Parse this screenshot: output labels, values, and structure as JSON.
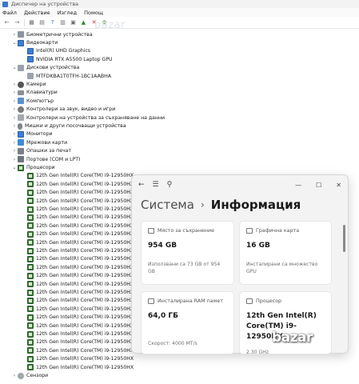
{
  "window_title": "Диспечер на устройства",
  "menu": [
    "Файл",
    "Действие",
    "Изглед",
    "Помощ"
  ],
  "watermark": "bazar",
  "tree": [
    {
      "level": 0,
      "expanded": false,
      "icon": "gray",
      "label": "Биометрични устройства"
    },
    {
      "level": 0,
      "expanded": true,
      "icon": "mon",
      "label": "Видеокарти"
    },
    {
      "level": 1,
      "icon": "mon",
      "label": "Intel(R) UHD Graphics"
    },
    {
      "level": 1,
      "icon": "mon",
      "label": "NVIDIA RTX A5500 Laptop GPU"
    },
    {
      "level": 0,
      "expanded": true,
      "icon": "disk",
      "label": "Дискови устройства"
    },
    {
      "level": 1,
      "icon": "disk",
      "label": "MTFDKBA1T0TFH-1BC1AABHA"
    },
    {
      "level": 0,
      "expanded": false,
      "icon": "cam",
      "label": "Камери"
    },
    {
      "level": 0,
      "expanded": false,
      "icon": "kbd",
      "label": "Клавиатури"
    },
    {
      "level": 0,
      "expanded": false,
      "icon": "pc",
      "label": "Компютър"
    },
    {
      "level": 0,
      "expanded": false,
      "icon": "snd",
      "label": "Контролери за звук, видео и игри"
    },
    {
      "level": 0,
      "expanded": false,
      "icon": "ctrl",
      "label": "Контролери на устройства за съхраняване на данни"
    },
    {
      "level": 0,
      "expanded": false,
      "icon": "mouse",
      "label": "Мишки и други посочващи устройства"
    },
    {
      "level": 0,
      "expanded": false,
      "icon": "mon",
      "label": "Монитори"
    },
    {
      "level": 0,
      "expanded": false,
      "icon": "net",
      "label": "Мрежови карти"
    },
    {
      "level": 0,
      "expanded": false,
      "icon": "prt",
      "label": "Опашки за печат"
    },
    {
      "level": 0,
      "expanded": false,
      "icon": "port",
      "label": "Портове (COM и LPT)"
    },
    {
      "level": 0,
      "expanded": true,
      "icon": "cpu",
      "label": "Процесори"
    },
    {
      "level": 1,
      "icon": "cpu",
      "label": "12th Gen Intel(R) Core(TM) i9-12950HX"
    },
    {
      "level": 1,
      "icon": "cpu",
      "label": "12th Gen Intel(R) Core(TM) i9-12950HX"
    },
    {
      "level": 1,
      "icon": "cpu",
      "label": "12th Gen Intel(R) Core(TM) i9-12950HX"
    },
    {
      "level": 1,
      "icon": "cpu",
      "label": "12th Gen Intel(R) Core(TM) i9-12950HX"
    },
    {
      "level": 1,
      "icon": "cpu",
      "label": "12th Gen Intel(R) Core(TM) i9-12950HX"
    },
    {
      "level": 1,
      "icon": "cpu",
      "label": "12th Gen Intel(R) Core(TM) i9-12950HX"
    },
    {
      "level": 1,
      "icon": "cpu",
      "label": "12th Gen Intel(R) Core(TM) i9-12950HX"
    },
    {
      "level": 1,
      "icon": "cpu",
      "label": "12th Gen Intel(R) Core(TM) i9-12950HX"
    },
    {
      "level": 1,
      "icon": "cpu",
      "label": "12th Gen Intel(R) Core(TM) i9-12950HX"
    },
    {
      "level": 1,
      "icon": "cpu",
      "label": "12th Gen Intel(R) Core(TM) i9-12950HX"
    },
    {
      "level": 1,
      "icon": "cpu",
      "label": "12th Gen Intel(R) Core(TM) i9-12950HX"
    },
    {
      "level": 1,
      "icon": "cpu",
      "label": "12th Gen Intel(R) Core(TM) i9-12950HX"
    },
    {
      "level": 1,
      "icon": "cpu",
      "label": "12th Gen Intel(R) Core(TM) i9-12950HX"
    },
    {
      "level": 1,
      "icon": "cpu",
      "label": "12th Gen Intel(R) Core(TM) i9-12950HX"
    },
    {
      "level": 1,
      "icon": "cpu",
      "label": "12th Gen Intel(R) Core(TM) i9-12950HX"
    },
    {
      "level": 1,
      "icon": "cpu",
      "label": "12th Gen Intel(R) Core(TM) i9-12950HX"
    },
    {
      "level": 1,
      "icon": "cpu",
      "label": "12th Gen Intel(R) Core(TM) i9-12950HX"
    },
    {
      "level": 1,
      "icon": "cpu",
      "label": "12th Gen Intel(R) Core(TM) i9-12950HX"
    },
    {
      "level": 1,
      "icon": "cpu",
      "label": "12th Gen Intel(R) Core(TM) i9-12950HX"
    },
    {
      "level": 1,
      "icon": "cpu",
      "label": "12th Gen Intel(R) Core(TM) i9-12950HX"
    },
    {
      "level": 1,
      "icon": "cpu",
      "label": "12th Gen Intel(R) Core(TM) i9-12950HX"
    },
    {
      "level": 1,
      "icon": "cpu",
      "label": "12th Gen Intel(R) Core(TM) i9-12950HX"
    },
    {
      "level": 1,
      "icon": "cpu",
      "label": "12th Gen Intel(R) Core(TM) i9-12950HX"
    },
    {
      "level": 1,
      "icon": "cpu",
      "label": "12th Gen Intel(R) Core(TM) i9-12950HX"
    },
    {
      "level": 0,
      "expanded": false,
      "icon": "sens",
      "label": "Сензори"
    }
  ],
  "settings": {
    "breadcrumb_parent": "Система",
    "breadcrumb_chevron": "›",
    "page_title": "Информация",
    "cards": [
      {
        "key": "storage",
        "title": "Място за съхранение",
        "value": "954 GB",
        "sub": "Използвани са 73 GB от 954 GB"
      },
      {
        "key": "gpu",
        "title": "Графична карта",
        "value": "16 GB",
        "sub": "Инсталирани са множество GPU"
      },
      {
        "key": "ram",
        "title": "Инсталирана RAM памет",
        "value": "64,0 ГБ",
        "sub": "Скорост: 4000 MT/s"
      },
      {
        "key": "cpu",
        "title": "Процесор",
        "value": "12th Gen Intel(R) Core(TM) i9-12950HX",
        "sub": "2.30 GHz"
      }
    ]
  },
  "overlay_logo": "bazar"
}
